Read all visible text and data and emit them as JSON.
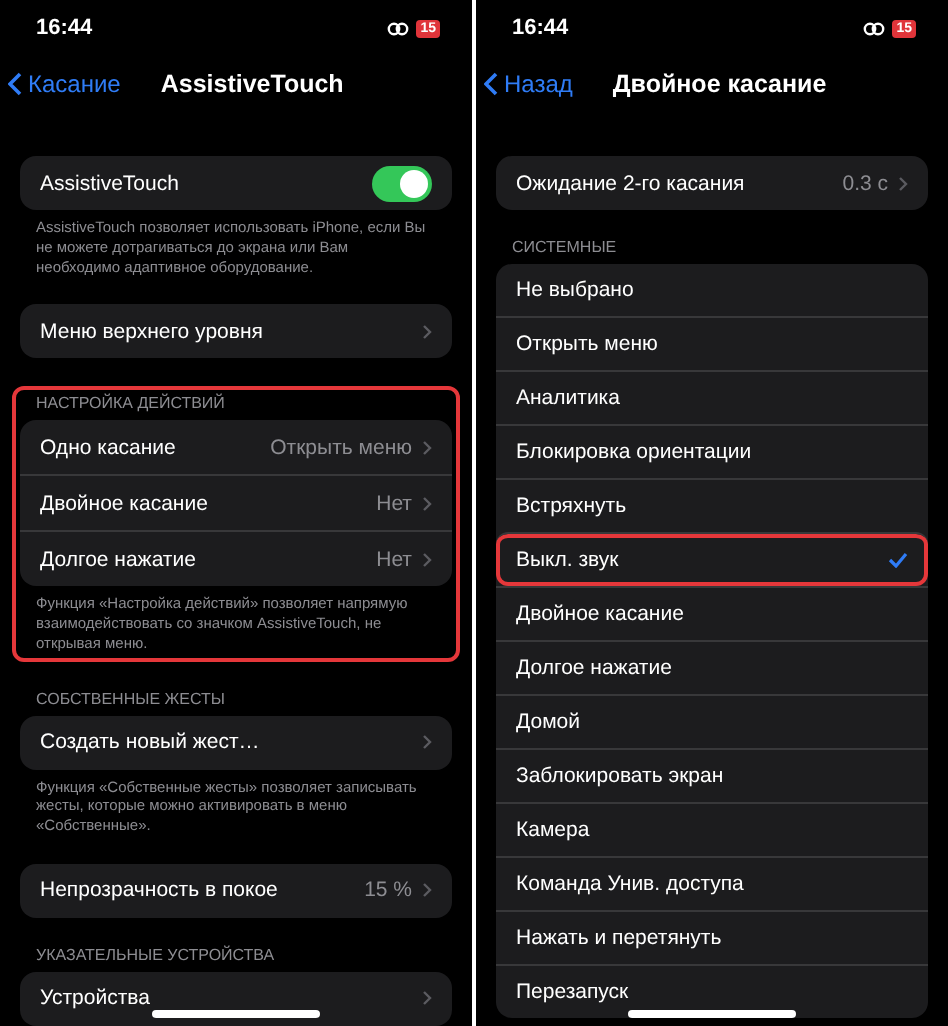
{
  "screens": [
    {
      "status_bar": {
        "time": "16:44",
        "battery": "15"
      },
      "nav": {
        "back": "Касание",
        "title": "AssistiveTouch"
      },
      "sections": [
        {
          "highlighted": false,
          "rows": [
            {
              "kind": "toggle",
              "label": "AssistiveTouch",
              "on": true
            }
          ],
          "footer": "AssistiveTouch позволяет использовать iPhone, если Вы не можете дотрагиваться до экрана или Вам необходимо адаптивное оборудование."
        },
        {
          "highlighted": false,
          "rows": [
            {
              "kind": "link",
              "label": "Меню верхнего уровня"
            }
          ]
        },
        {
          "highlighted": true,
          "header": "НАСТРОЙКА ДЕЙСТВИЙ",
          "rows": [
            {
              "kind": "link",
              "label": "Одно касание",
              "value": "Открыть меню"
            },
            {
              "kind": "link",
              "label": "Двойное касание",
              "value": "Нет"
            },
            {
              "kind": "link",
              "label": "Долгое нажатие",
              "value": "Нет"
            }
          ],
          "footer": "Функция «Настройка действий» позволяет напрямую взаимодействовать со значком AssistiveTouch, не открывая меню."
        },
        {
          "highlighted": false,
          "header": "СОБСТВЕННЫЕ ЖЕСТЫ",
          "rows": [
            {
              "kind": "link",
              "label": "Создать новый жест…"
            }
          ],
          "footer": "Функция «Собственные жесты» позволяет записывать жесты, которые можно активировать в меню «Собственные»."
        },
        {
          "highlighted": false,
          "rows": [
            {
              "kind": "link",
              "label": "Непрозрачность в покое",
              "value": "15 %"
            }
          ]
        },
        {
          "highlighted": false,
          "header": "УКАЗАТЕЛЬНЫЕ УСТРОЙСТВА",
          "rows": [
            {
              "kind": "link",
              "label": "Устройства"
            }
          ]
        }
      ]
    },
    {
      "status_bar": {
        "time": "16:44",
        "battery": "15"
      },
      "nav": {
        "back": "Назад",
        "title": "Двойное касание"
      },
      "sections": [
        {
          "highlighted": false,
          "rows": [
            {
              "kind": "link",
              "label": "Ожидание 2-го касания",
              "value": "0.3 с"
            }
          ]
        },
        {
          "highlighted": false,
          "header": "СИСТЕМНЫЕ",
          "rows": [
            {
              "kind": "check",
              "label": "Не выбрано",
              "selected": false,
              "highlighted": false
            },
            {
              "kind": "check",
              "label": "Открыть меню",
              "selected": false,
              "highlighted": false
            },
            {
              "kind": "check",
              "label": "Аналитика",
              "selected": false,
              "highlighted": false
            },
            {
              "kind": "check",
              "label": "Блокировка ориентации",
              "selected": false,
              "highlighted": false
            },
            {
              "kind": "check",
              "label": "Встряхнуть",
              "selected": false,
              "highlighted": false
            },
            {
              "kind": "check",
              "label": "Выкл. звук",
              "selected": true,
              "highlighted": true
            },
            {
              "kind": "check",
              "label": "Двойное касание",
              "selected": false,
              "highlighted": false
            },
            {
              "kind": "check",
              "label": "Долгое нажатие",
              "selected": false,
              "highlighted": false
            },
            {
              "kind": "check",
              "label": "Домой",
              "selected": false,
              "highlighted": false
            },
            {
              "kind": "check",
              "label": "Заблокировать экран",
              "selected": false,
              "highlighted": false
            },
            {
              "kind": "check",
              "label": "Камера",
              "selected": false,
              "highlighted": false
            },
            {
              "kind": "check",
              "label": "Команда Унив. доступа",
              "selected": false,
              "highlighted": false
            },
            {
              "kind": "check",
              "label": "Нажать и перетянуть",
              "selected": false,
              "highlighted": false
            },
            {
              "kind": "check",
              "label": "Перезапуск",
              "selected": false,
              "highlighted": false
            }
          ]
        }
      ]
    }
  ]
}
